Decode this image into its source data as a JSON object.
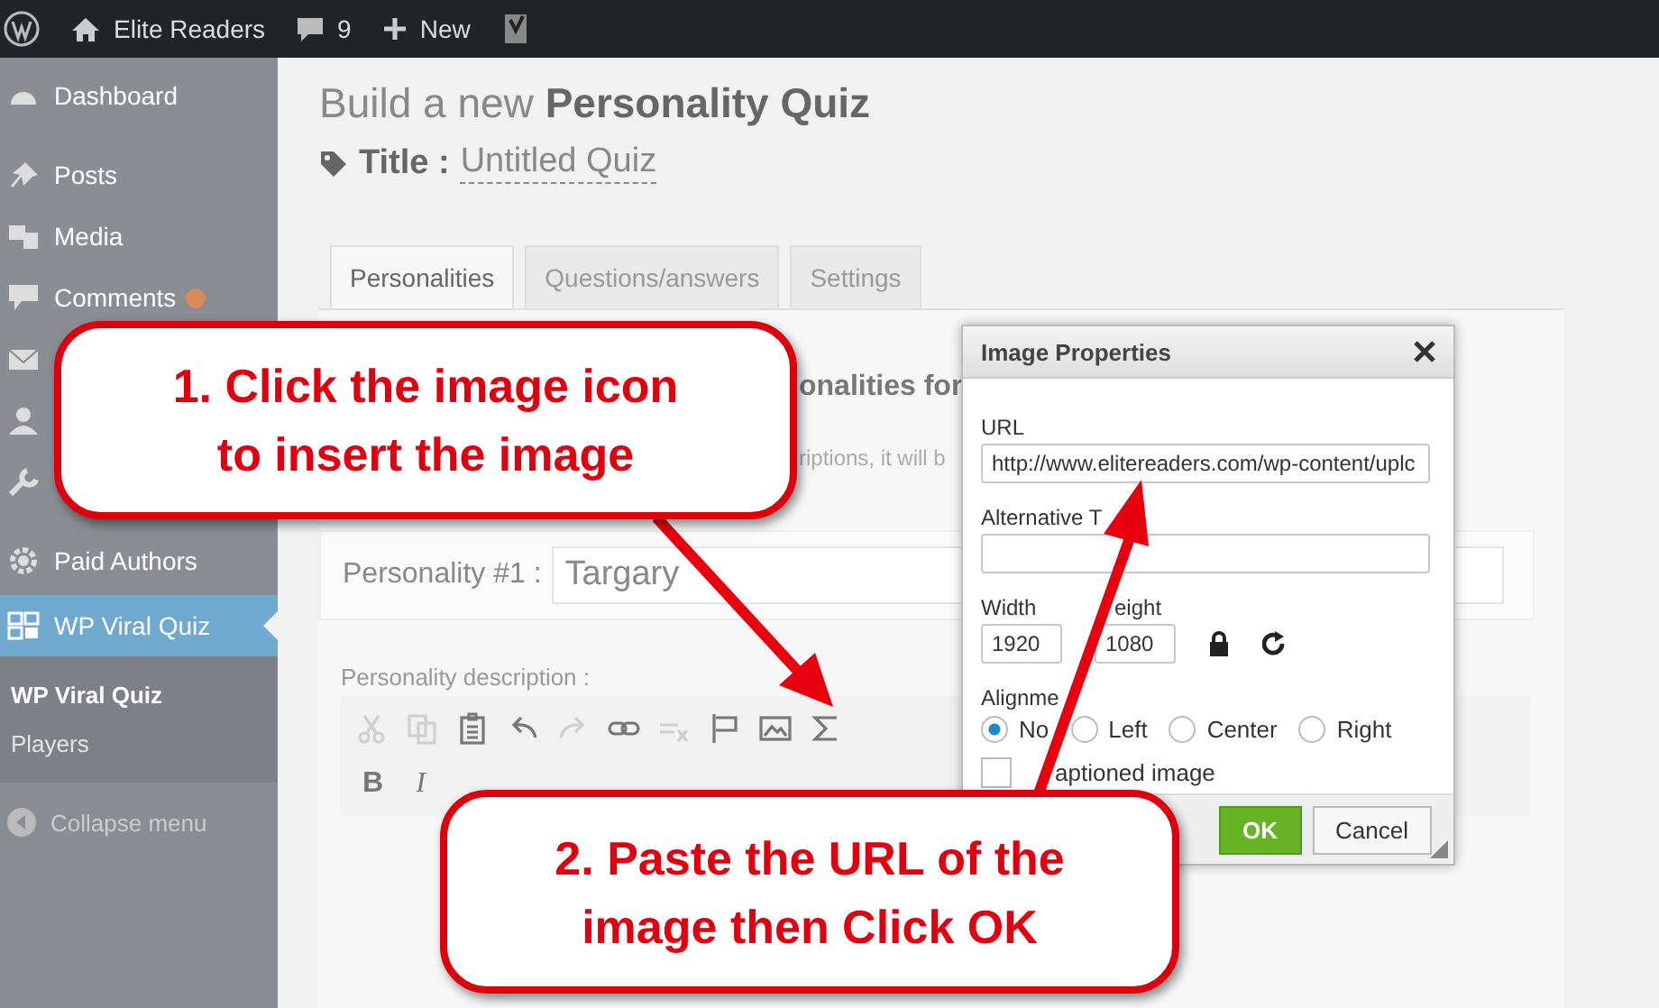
{
  "admin_bar": {
    "items": [
      {
        "kind": "logo"
      },
      {
        "kind": "home",
        "label": "Elite Readers"
      },
      {
        "kind": "comments",
        "label": "9"
      },
      {
        "kind": "new",
        "label": "New"
      },
      {
        "kind": "seo"
      }
    ]
  },
  "sidebar": {
    "items": [
      {
        "kind": "dashboard",
        "label": "Dashboard",
        "selected": false
      },
      {
        "kind": "posts",
        "label": "Posts",
        "selected": false
      },
      {
        "kind": "media",
        "label": "Media",
        "selected": false
      },
      {
        "kind": "comments",
        "label": "Comments",
        "selected": false
      },
      {
        "kind": "mail",
        "selected": false
      },
      {
        "kind": "user",
        "selected": false
      },
      {
        "kind": "tools",
        "selected": false
      },
      {
        "kind": "gear",
        "label": "Paid Authors",
        "selected": false
      },
      {
        "kind": "quiz",
        "label": "WP Viral Quiz",
        "selected": true
      }
    ],
    "submenu": [
      {
        "label": "WP Viral Quiz",
        "selected": true
      },
      {
        "label": "Players",
        "selected": false
      }
    ],
    "collapse": "Collapse menu"
  },
  "page": {
    "heading": "Build a new **Personality Quiz**",
    "title_label": "Title :",
    "title_value": "Untitled Quiz",
    "tabs": [
      {
        "label": "Personalities",
        "selected": true
      },
      {
        "label": "Questions/answers",
        "selected": false
      },
      {
        "label": "Settings",
        "selected": false
      }
    ],
    "section_heading": "onalities for",
    "section_note": "riptions, it will b",
    "personality_label": "Personality #1 :",
    "personality_value": "Targary",
    "description_label": "Personality description :",
    "toolbar_rows": [
      [
        {
          "kind": "cut",
          "disabled": true
        },
        {
          "kind": "copy",
          "disabled": true
        },
        {
          "kind": "paste",
          "disabled": false
        },
        {
          "kind": "undo",
          "disabled": false
        },
        {
          "kind": "redo",
          "disabled": true
        },
        {
          "kind": "link",
          "disabled": false
        },
        {
          "kind": "unlink",
          "disabled": true
        },
        {
          "kind": "anchor",
          "disabled": false
        },
        {
          "kind": "image",
          "disabled": false
        },
        {
          "kind": "sigma",
          "disabled": false
        }
      ],
      [
        {
          "kind": "bold",
          "label": "B",
          "disabled": false
        },
        {
          "kind": "italic",
          "label": "I",
          "disabled": false
        }
      ]
    ]
  },
  "dialog": {
    "title": "Image Properties",
    "url_label": "URL",
    "url_value": "http://www.elitereaders.com/wp-content/uplc",
    "alt_label": "Alternative T",
    "width_label": "Width",
    "width_value": "1920",
    "height_label": "eight",
    "height_value": "1080",
    "alignment_label": "Alignme",
    "alignments": [
      {
        "label": "No",
        "selected": true
      },
      {
        "label": "Left",
        "selected": false
      },
      {
        "label": "Center",
        "selected": false
      },
      {
        "label": "Right",
        "selected": false
      }
    ],
    "caption": {
      "label": "aptioned image",
      "checked": false
    },
    "ok": "OK",
    "cancel": "Cancel"
  },
  "callouts": [
    {
      "text": "1. Click the image icon\nto insert the image"
    },
    {
      "text": "2. Paste the URL of the\nimage then Click OK"
    }
  ]
}
